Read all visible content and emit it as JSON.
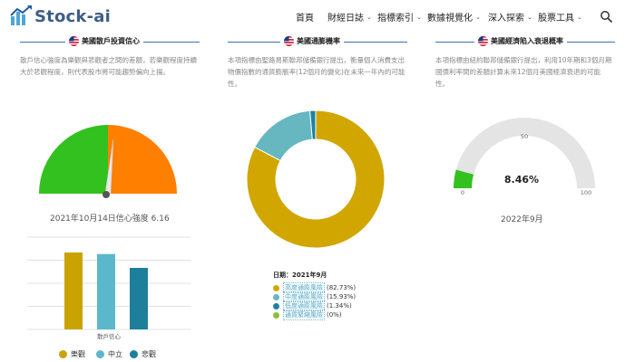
{
  "app": {
    "logo_text": "Stock-ai"
  },
  "nav": {
    "items": [
      {
        "label": "首頁",
        "has_menu": false
      },
      {
        "label": "財經日誌",
        "has_menu": true
      },
      {
        "label": "指標索引",
        "has_menu": true
      },
      {
        "label": "數據視覺化",
        "has_menu": true
      },
      {
        "label": "深入探索",
        "has_menu": true
      },
      {
        "label": "股票工具",
        "has_menu": true
      }
    ],
    "caret": "⌄"
  },
  "sections": {
    "consumer": {
      "title": "美國散戶投資信心",
      "desc": "散戶信心強度為樂觀與悲觀者之間的差額，若樂觀程度持續大於悲觀程度，則代表股市將可能趨勢偏向上揚。",
      "caption": "2021年10月14日信心強度 6.16"
    },
    "inflation": {
      "title": "美國通膨機率",
      "desc": "本項指標由聖路易斯聯邦儲備銀行提出，衡量個人消費支出物價指數的通貨膨脹率(12個月的變化)在未來一年內的可能性。",
      "date_label": "日期：2021年9月"
    },
    "recession": {
      "title": "美國經濟陷入衰退概率",
      "desc": "本項指標由紐約聯邦儲備銀行提出，利用10年期和3個月期國債利率間的差額計算未來12個月美國經濟衰退的可能性。",
      "caption": "2022年9月",
      "value_text": "8.46%"
    }
  },
  "chart_data": [
    {
      "type": "pie",
      "name": "consumer-gauge",
      "slices": [
        {
          "label": "樂觀",
          "value": 50,
          "color": "#33c11f"
        },
        {
          "label": "悲觀",
          "value": 50,
          "color": "#ff7f00"
        }
      ],
      "needle_value": 6.16
    },
    {
      "type": "bar",
      "name": "consumer-bars",
      "categories": [
        "散戶信心"
      ],
      "series": [
        {
          "name": "樂觀",
          "values": [
            100
          ],
          "color": "#c9a400"
        },
        {
          "name": "中立",
          "values": [
            98
          ],
          "color": "#5bb8cc"
        },
        {
          "name": "悲觀",
          "values": [
            80
          ],
          "color": "#1d7f9c"
        }
      ],
      "ylim": [
        0,
        120
      ]
    },
    {
      "type": "pie",
      "name": "inflation-donut",
      "slices": [
        {
          "label": "高度通膨風險",
          "value": 82.73,
          "value_text": "(82.73%)",
          "color": "#d2a600"
        },
        {
          "label": "中度通膨風險",
          "value": 15.93,
          "value_text": "(15.93%)",
          "color": "#67b7c1"
        },
        {
          "label": "低度通膨風險",
          "value": 1.34,
          "value_text": "(1.34%)",
          "color": "#1d82a4"
        },
        {
          "label": "通貨緊縮風險",
          "value": 0,
          "value_text": "(0%)",
          "color": "#8fbf3a"
        }
      ]
    },
    {
      "type": "pie",
      "name": "recession-gauge",
      "value": 8.46,
      "range": [
        0,
        100
      ],
      "ticks": [
        "0",
        "50",
        "100"
      ],
      "fill_color": "#33c11f",
      "track_color": "#e4e4e4"
    }
  ]
}
